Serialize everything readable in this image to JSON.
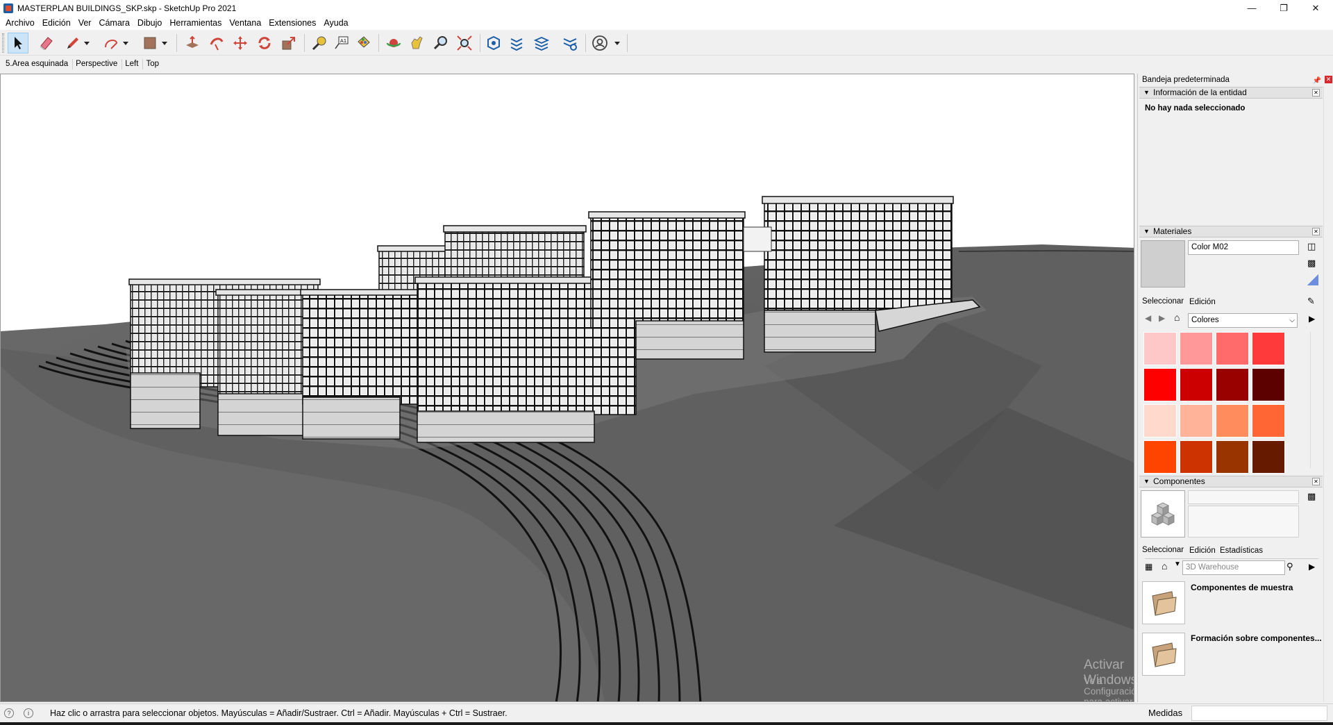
{
  "window": {
    "title": "MASTERPLAN BUILDINGS_SKP.skp - SketchUp Pro 2021",
    "minimize": "—",
    "restore": "❐",
    "close": "✕"
  },
  "menu": [
    "Archivo",
    "Edición",
    "Ver",
    "Cámara",
    "Dibujo",
    "Herramientas",
    "Ventana",
    "Extensiones",
    "Ayuda"
  ],
  "scenes": [
    "5.Area esquinada",
    "Perspective",
    "Left",
    "Top"
  ],
  "toolbar": {
    "icons": [
      "select-icon",
      "eraser-icon",
      "pencil-icon",
      "dropdown-icon",
      "arc-icon",
      "dropdown-icon",
      "rectangle-icon",
      "dropdown-icon",
      "push-pull-icon",
      "follow-me-icon",
      "move-icon",
      "rotate-icon",
      "scale-icon",
      "tape-measure-icon",
      "text-icon",
      "paint-bucket-icon",
      "orbit-icon",
      "pan-icon",
      "zoom-icon",
      "zoom-extents-icon",
      "warehouse-icon",
      "extension-warehouse-icon",
      "layout-icon",
      "extension-manager-icon",
      "account-icon",
      "dropdown-icon"
    ]
  },
  "status": {
    "hint": "Haz clic o arrastra para seleccionar objetos. Mayúsculas = Añadir/Sustraer. Ctrl = Añadir. Mayúsculas + Ctrl = Sustraer.",
    "measures_label": "Medidas",
    "measures_value": ""
  },
  "watermark": {
    "line1": "Activar Windows",
    "line2": "Ve a Configuración para activar Windows."
  },
  "tray": {
    "title": "Bandeja predeterminada",
    "entity": {
      "header": "Información de la entidad",
      "message": "No hay nada seleccionado"
    },
    "materials": {
      "header": "Materiales",
      "name": "Color M02",
      "tab_select": "Seleccionar",
      "tab_edit": "Edición",
      "library": "Colores",
      "swatches": [
        "#ffc8c8",
        "#ff9999",
        "#ff6b6b",
        "#ff3a3a",
        "#ff0000",
        "#cc0000",
        "#990000",
        "#5c0000",
        "#ffd9cc",
        "#ffb399",
        "#ff8c5c",
        "#ff6633",
        "#ff4400",
        "#cc3300",
        "#993300",
        "#661a00"
      ]
    },
    "components": {
      "header": "Componentes",
      "tab_select": "Seleccionar",
      "tab_edit": "Edición",
      "tab_stats": "Estadísticas",
      "search_placeholder": "3D Warehouse",
      "items": [
        "Componentes de muestra",
        "Formación sobre componentes..."
      ]
    }
  }
}
